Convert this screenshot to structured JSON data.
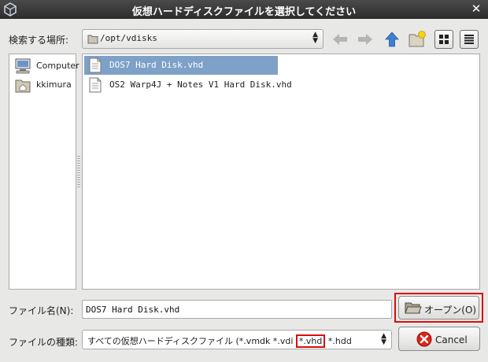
{
  "window": {
    "title": "仮想ハードディスクファイルを選択してください",
    "close_glyph": "✕"
  },
  "location": {
    "label": "検索する場所:",
    "path": "/opt/vdisks"
  },
  "places": {
    "items": [
      {
        "label": "Computer",
        "icon": "computer-icon"
      },
      {
        "label": "kkimura",
        "icon": "home-folder-icon"
      }
    ]
  },
  "files": {
    "items": [
      {
        "name": "DOS7 Hard Disk.vhd",
        "selected": true
      },
      {
        "name": "OS2 Warp4J + Notes V1 Hard Disk.vhd",
        "selected": false
      }
    ]
  },
  "filename": {
    "label": "ファイル名(N):",
    "value": "DOS7 Hard Disk.vhd"
  },
  "filetype": {
    "label": "ファイルの種類:",
    "prefix": "すべての仮想ハードディスクファイル (*.vmdk *.vdi ",
    "highlight": "*.vhd",
    "suffix": " *.hdd"
  },
  "buttons": {
    "open_label": "オープン(O)",
    "cancel_label": "Cancel"
  },
  "colors": {
    "selection": "#7ea1c7",
    "highlight_box": "#d80f0f",
    "titlebar": "#2c2c2c"
  }
}
